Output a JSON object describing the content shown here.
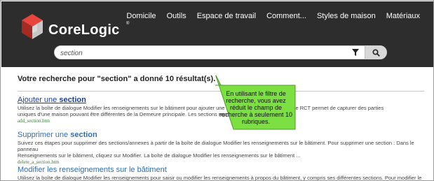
{
  "brand": {
    "name": "CoreLogic",
    "reg_mark": "®"
  },
  "nav": {
    "items": [
      {
        "label": "Domicile"
      },
      {
        "label": "Outils"
      },
      {
        "label": "Espace de travail"
      },
      {
        "label": "Comment..."
      },
      {
        "label": "Styles de maison"
      },
      {
        "label": "Matériaux"
      }
    ]
  },
  "search": {
    "value": "section"
  },
  "results": {
    "heading": "Votre recherche pour \"section\" a donné 10 résultat(s).",
    "items": [
      {
        "title_prefix": "Ajouter une ",
        "title_bold": "section",
        "desc_line1": "Utilisez la boîte de dialogue Modifier les renseignements sur le bâtiment pour ajouter une nouvelle ... Section (ou aile) de RCT permet de capturer des parties",
        "desc_line2": "uniques d'une maison pouvant être différentes de la Demeure principale. Les sections repr...",
        "url": "add_section.htm"
      },
      {
        "title_prefix": "Supprimer une ",
        "title_bold": "section",
        "desc_line1": "Suivez ces étapes pour supprimer des sections/annexes à partir de la boîte de dialogue Modifier les renseignements sur le bâtiment. Pour supprimer une section : Dans le panneau",
        "desc_line2": "Renseignements sur le bâtiment, cliquez sur Modifier. La boîte de dialogue Modifier les renseignements sur le bâtiment ...",
        "url": "delete_a_section.htm"
      },
      {
        "title_prefix": "Modifier les renseignements sur le bâtiment",
        "title_bold": "",
        "desc_line1": "Utilisez la boîte de dialogue Modifier les renseignements pour saisir ou modifier les renseignements à propos du bâtiment, y compris ses différentes sections. Pour modifier le",
        "desc_line2": "",
        "url": ""
      }
    ]
  },
  "callout": {
    "text": "En utilisant le filtre de recherche, vous avez réduit le champ de recherche à seulement 10 rubriques."
  }
}
